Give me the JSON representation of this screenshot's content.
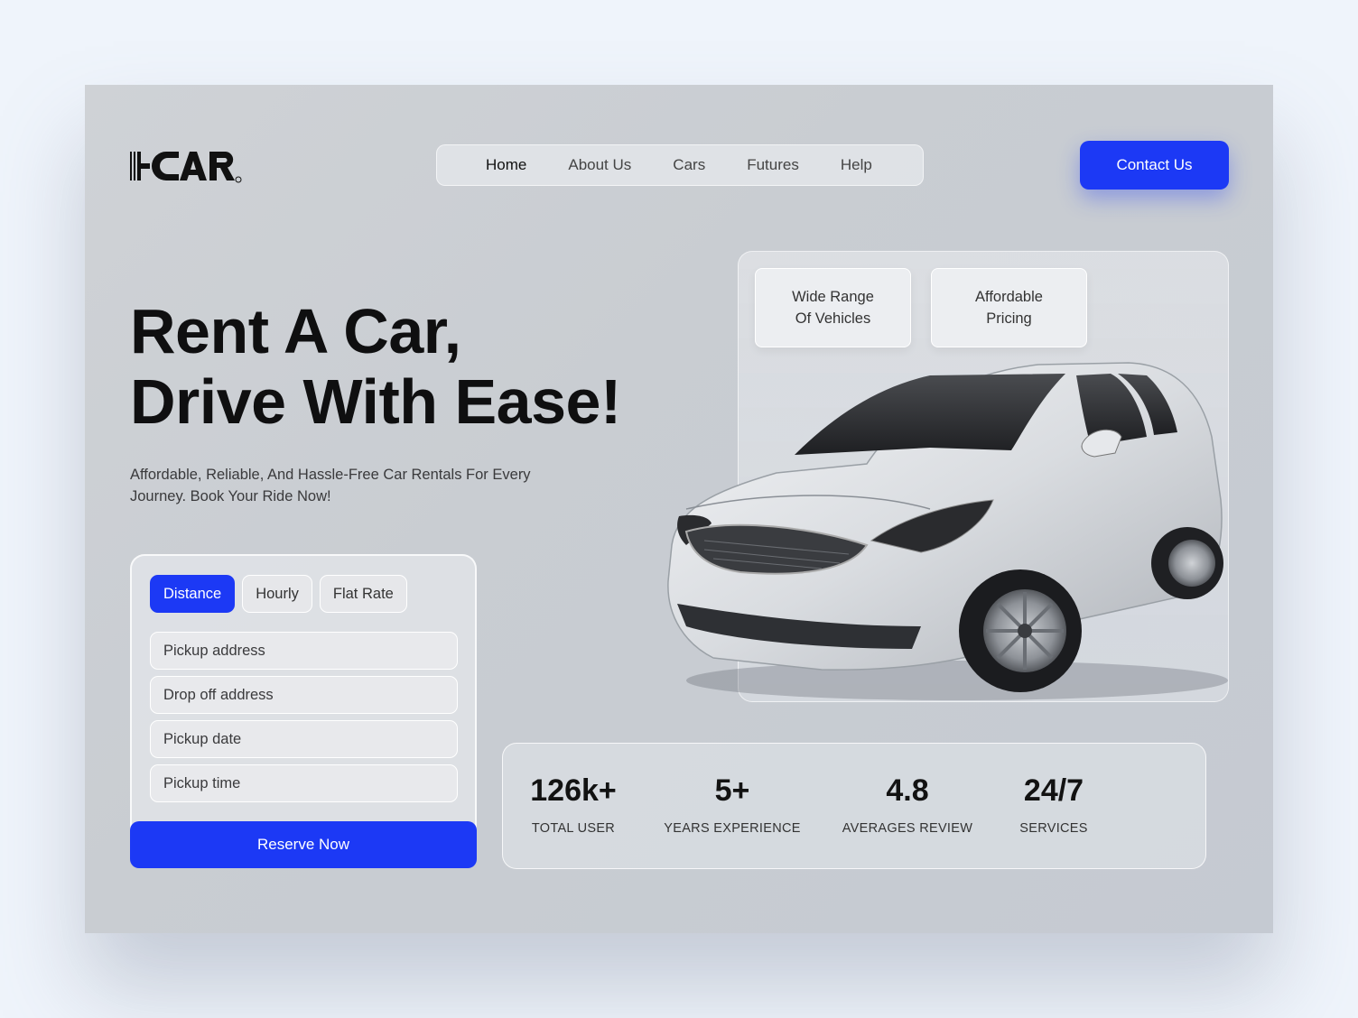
{
  "brand": {
    "logo_text": "I-CAR",
    "accent": "#1c39f5"
  },
  "nav": {
    "items": [
      {
        "label": "Home",
        "active": true
      },
      {
        "label": "About Us",
        "active": false
      },
      {
        "label": "Cars",
        "active": false
      },
      {
        "label": "Futures",
        "active": false
      },
      {
        "label": "Help",
        "active": false
      }
    ],
    "contact_label": "Contact Us"
  },
  "hero": {
    "title_line1": "Rent A Car,",
    "title_line2": "Drive With Ease!",
    "subtitle": "Affordable, Reliable, And Hassle-Free Car Rentals For Every Journey. Book Your Ride Now!"
  },
  "booking": {
    "tabs": [
      {
        "label": "Distance",
        "selected": true
      },
      {
        "label": "Hourly",
        "selected": false
      },
      {
        "label": "Flat Rate",
        "selected": false
      }
    ],
    "fields": {
      "pickup_address": "Pickup address",
      "dropoff_address": "Drop off address",
      "pickup_date": "Pickup date",
      "pickup_time": "Pickup time"
    },
    "reserve_label": "Reserve Now"
  },
  "features": {
    "first": "Wide Range Of Vehicles",
    "second": "Affordable Pricing"
  },
  "stats": [
    {
      "value": "126k+",
      "label": "TOTAL USER"
    },
    {
      "value": "5+",
      "label": "YEARS EXPERIENCE"
    },
    {
      "value": "4.8",
      "label": "AVERAGES REVIEW"
    },
    {
      "value": "24/7",
      "label": "SERVICES"
    }
  ]
}
